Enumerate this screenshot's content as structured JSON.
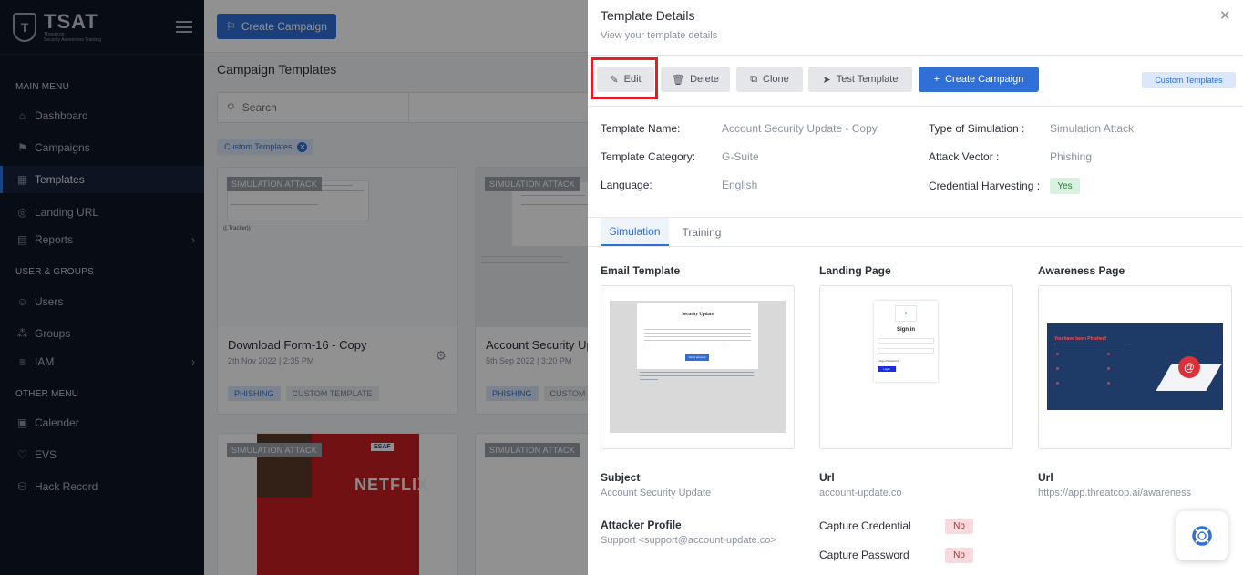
{
  "sidebar": {
    "brand_name": "TSAT",
    "brand_sub_line1": "Threatcop",
    "brand_sub_line2": "Security Awareness Training",
    "sections": [
      {
        "label": "MAIN MENU"
      },
      {
        "label": "USER & GROUPS"
      },
      {
        "label": "OTHER MENU"
      }
    ],
    "items": [
      {
        "label": "Dashboard",
        "icon": "home-icon"
      },
      {
        "label": "Campaigns",
        "icon": "flag-icon"
      },
      {
        "label": "Templates",
        "icon": "templates-icon"
      },
      {
        "label": "Landing URL",
        "icon": "globe-icon"
      },
      {
        "label": "Reports",
        "icon": "report-icon"
      },
      {
        "label": "Users",
        "icon": "users-icon"
      },
      {
        "label": "Groups",
        "icon": "groups-icon"
      },
      {
        "label": "IAM",
        "icon": "iam-icon"
      },
      {
        "label": "Calender",
        "icon": "calendar-icon"
      },
      {
        "label": "EVS",
        "icon": "shield-heart-icon"
      },
      {
        "label": "Hack Record",
        "icon": "database-icon"
      }
    ]
  },
  "main": {
    "create_campaign_label": "Create Campaign",
    "page_title": "Campaign Templates",
    "search_placeholder": "Search",
    "filter_chip": "Custom Templates",
    "cards": [
      {
        "badge": "SIMULATION ATTACK",
        "title": "Download Form-16 - Copy",
        "date": "2th Nov 2022 | 2:35 PM",
        "tags": [
          "PHISHING",
          "CUSTOM TEMPLATE"
        ],
        "thumb_snippet": "{{.Tracker}}"
      },
      {
        "badge": "SIMULATION ATTACK",
        "title": "Account Security Up",
        "date": "5th Sep 2022 | 3:20 PM",
        "tags": [
          "PHISHING",
          "CUSTOM"
        ]
      },
      {
        "badge": "SIMULATION ATTACK",
        "thumb_brand": "NETFLIX",
        "thumb_logo": "ESAF"
      },
      {
        "badge": "SIMULATION ATTACK"
      }
    ]
  },
  "panel": {
    "title": "Template Details",
    "subtitle": "View your template details",
    "actions": {
      "edit": "Edit",
      "delete": "Delete",
      "clone": "Clone",
      "test": "Test Template",
      "create": "Create Campaign"
    },
    "custom_tag": "Custom Templates",
    "details": {
      "template_name_label": "Template Name:",
      "template_name": "Account Security Update - Copy",
      "category_label": "Template Category:",
      "category": "G-Suite",
      "language_label": "Language:",
      "language": "English",
      "sim_type_label": "Type of Simulation :",
      "sim_type": "Simulation Attack",
      "attack_vector_label": "Attack Vector :",
      "attack_vector": "Phishing",
      "cred_harvest_label": "Credential Harvesting :",
      "cred_harvest": "Yes"
    },
    "tabs": [
      "Simulation",
      "Training"
    ],
    "sections": {
      "email_template": "Email Template",
      "landing_page": "Landing Page",
      "awareness_page": "Awareness Page"
    },
    "email_preview": {
      "heading": "Security Update",
      "button": "Verify account"
    },
    "landing_preview": {
      "heading": "Sign in",
      "forgot": "Forgot Password",
      "button": "Login"
    },
    "awareness_preview": {
      "heading": "You have been Phished!"
    },
    "subject_label": "Subject",
    "subject": "Account Security Update",
    "url_label": "Url",
    "landing_url": "account-update.co",
    "awareness_url_label": "Url",
    "awareness_url": "https://app.threatcop.ai/awareness",
    "attacker_label": "Attacker Profile",
    "attacker": "Support <support@account-update.co>",
    "capture_credential_label": "Capture Credential",
    "capture_credential": "No",
    "capture_password_label": "Capture Password",
    "capture_password": "No"
  },
  "colors": {
    "primary": "#2f6fd6",
    "sidebar_bg": "#0d1626",
    "highlight_outline": "#e11d25",
    "yes_bg": "#d9f1df",
    "no_bg": "#f9d9db"
  }
}
